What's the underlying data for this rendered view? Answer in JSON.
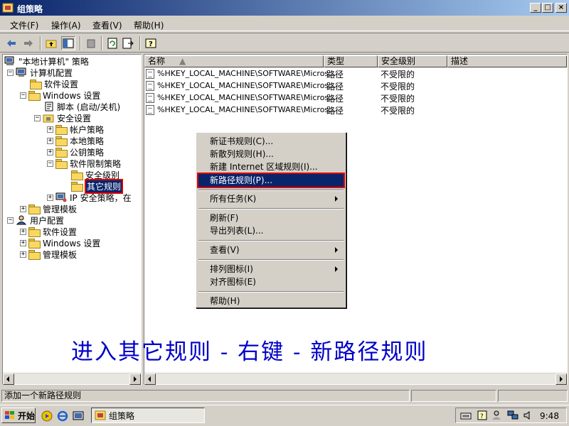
{
  "window": {
    "title": "组策略"
  },
  "menubar": [
    {
      "label": "文件(F)"
    },
    {
      "label": "操作(A)"
    },
    {
      "label": "查看(V)"
    },
    {
      "label": "帮助(H)"
    }
  ],
  "tree": {
    "root": "\"本地计算机\" 策略",
    "computer_config": "计算机配置",
    "software_settings": "软件设置",
    "windows_settings": "Windows 设置",
    "scripts": "脚本 (启动/关机)",
    "security_settings": "安全设置",
    "account_policies": "帐户策略",
    "local_policies": "本地策略",
    "public_key": "公钥策略",
    "software_restriction": "软件限制策略",
    "security_levels": "安全级别",
    "other_rules": "其它规则",
    "ip_security": "IP 安全策略，在",
    "admin_templates": "管理模板",
    "user_config": "用户配置",
    "user_software": "软件设置",
    "user_windows": "Windows 设置",
    "user_admin": "管理模板"
  },
  "list": {
    "columns": [
      "名称",
      "类型",
      "安全级别",
      "描述"
    ],
    "rows": [
      {
        "name": "%HKEY_LOCAL_MACHINE\\SOFTWARE\\Micros...",
        "type": "路径",
        "level": "不受限的"
      },
      {
        "name": "%HKEY_LOCAL_MACHINE\\SOFTWARE\\Micros...",
        "type": "路径",
        "level": "不受限的"
      },
      {
        "name": "%HKEY_LOCAL_MACHINE\\SOFTWARE\\Micros...",
        "type": "路径",
        "level": "不受限的"
      },
      {
        "name": "%HKEY_LOCAL_MACHINE\\SOFTWARE\\Micros...",
        "type": "路径",
        "level": "不受限的"
      }
    ]
  },
  "context_menu": {
    "new_cert_rule": "新证书规则(C)...",
    "new_hash_rule": "新散列规则(H)...",
    "new_zone_rule": "新建 Internet 区域规则(I)...",
    "new_path_rule": "新路径规则(P)...",
    "all_tasks": "所有任务(K)",
    "refresh": "刷新(F)",
    "export_list": "导出列表(L)...",
    "view": "查看(V)",
    "arrange_icons": "排列图标(I)",
    "line_up_icons": "对齐图标(E)",
    "help": "帮助(H)"
  },
  "caption": "进入其它规则 - 右键 - 新路径规则",
  "statusbar": {
    "text": "添加一个新路径规则"
  },
  "taskbar": {
    "start": "开始",
    "task": "组策略",
    "clock": "9:48"
  },
  "colors": {
    "title_start": "#0a246a",
    "title_end": "#a6caf0",
    "highlight": "#0a246a",
    "callout": "#e00000",
    "caption": "#0000c8"
  }
}
